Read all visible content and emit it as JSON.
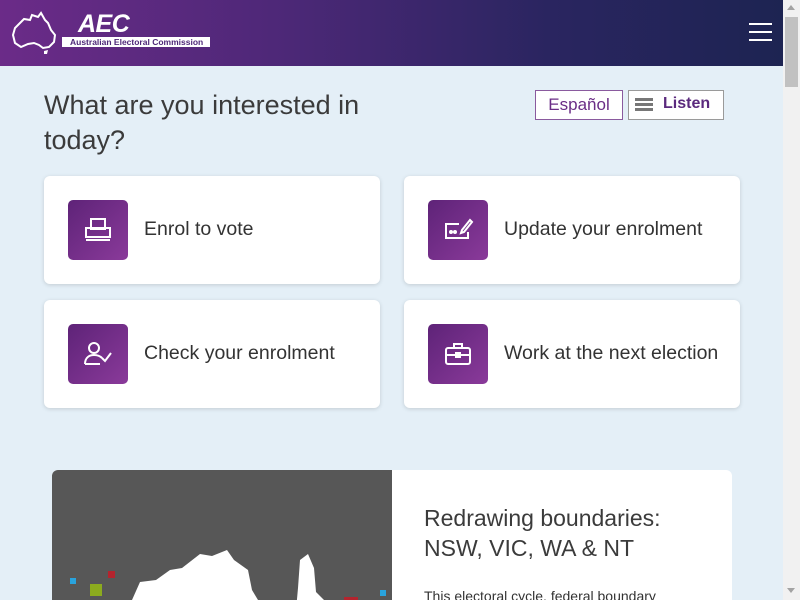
{
  "header": {
    "logo_title": "AEC",
    "logo_subtitle": "Australian Electoral Commission",
    "menu_icon": "hamburger-icon"
  },
  "main": {
    "question": "What are you interested in today?",
    "language_button": "Español",
    "listen_button": "Listen",
    "cards": [
      {
        "label": "Enrol to vote",
        "icon": "printer-form-icon"
      },
      {
        "label": "Update your enrolment",
        "icon": "edit-form-icon"
      },
      {
        "label": "Check your enrolment",
        "icon": "user-check-icon"
      },
      {
        "label": "Work at the next election",
        "icon": "briefcase-icon"
      }
    ]
  },
  "feature": {
    "title": "Redrawing boundaries: NSW, VIC, WA & NT",
    "text": "This electoral cycle, federal boundary"
  },
  "colors": {
    "brand_purple": "#5e2378",
    "header_dark": "#1d2452",
    "page_background": "#e4eff7"
  }
}
